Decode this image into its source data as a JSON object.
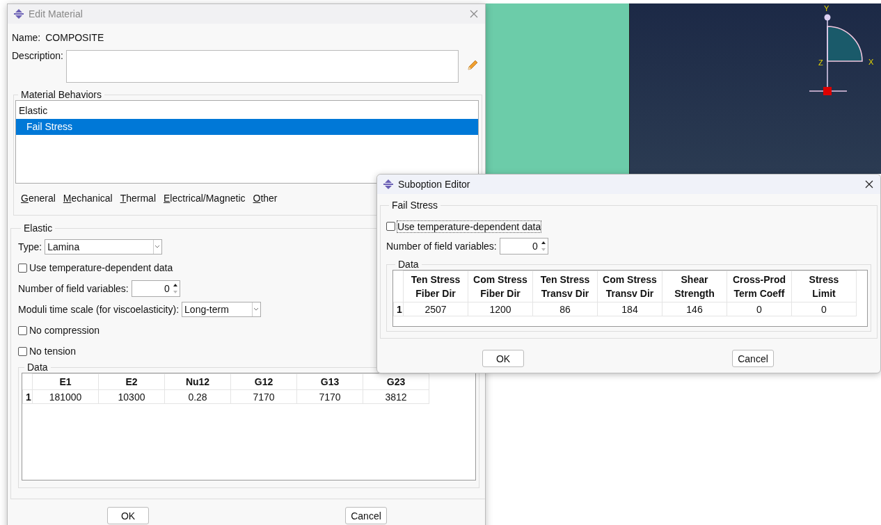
{
  "viewport": {
    "axis_labels": [
      "Y",
      "Z",
      "X"
    ]
  },
  "edit_material": {
    "title": "Edit Material",
    "name_label": "Name:",
    "name": "COMPOSITE",
    "description_label": "Description:",
    "behaviors_title": "Material Behaviors",
    "behaviors": [
      {
        "label": "Elastic",
        "selected": false,
        "children": [
          {
            "label": "Fail Stress",
            "selected": true
          }
        ]
      }
    ],
    "menus": [
      "General",
      "Mechanical",
      "Thermal",
      "Electrical/Magnetic",
      "Other"
    ],
    "section_title": "Elastic",
    "type_label": "Type:",
    "type": "Lamina",
    "temperature_dependent": {
      "label": "Use temperature-dependent data",
      "checked": false
    },
    "field_variables": {
      "label": "Number of field variables:",
      "value": "0"
    },
    "time_scale": {
      "label": "Moduli time scale (for viscoelasticity):",
      "value": "Long-term"
    },
    "no_compression": {
      "label": "No compression",
      "checked": false
    },
    "no_tension": {
      "label": "No tension",
      "checked": false
    },
    "data": {
      "title": "Data",
      "columns": [
        "E1",
        "E2",
        "Nu12",
        "G12",
        "G13",
        "G23"
      ],
      "rows": [
        {
          "index": "1",
          "cells": [
            "181000",
            "10300",
            "0.28",
            "7170",
            "7170",
            "3812"
          ]
        }
      ]
    },
    "buttons": [
      "OK",
      "Cancel"
    ]
  },
  "suboption": {
    "title": "Suboption Editor",
    "section_title": "Fail Stress",
    "temperature_dependent": {
      "label": "Use temperature-dependent data",
      "checked": false
    },
    "field_variables": {
      "label": "Number of field variables:",
      "value": "0"
    },
    "data": {
      "title": "Data",
      "columns": [
        "Ten Stress\nFiber Dir",
        "Com Stress\nFiber Dir",
        "Ten Stress\nTransv Dir",
        "Com Stress\nTransv Dir",
        "Shear\nStrength",
        "Cross-Prod\nTerm Coeff",
        "Stress\nLimit"
      ],
      "rows": [
        {
          "index": "1",
          "cells": [
            "2507",
            "1200",
            "86",
            "184",
            "146",
            "0",
            "0"
          ]
        }
      ]
    },
    "buttons": [
      "OK",
      "Cancel"
    ]
  }
}
